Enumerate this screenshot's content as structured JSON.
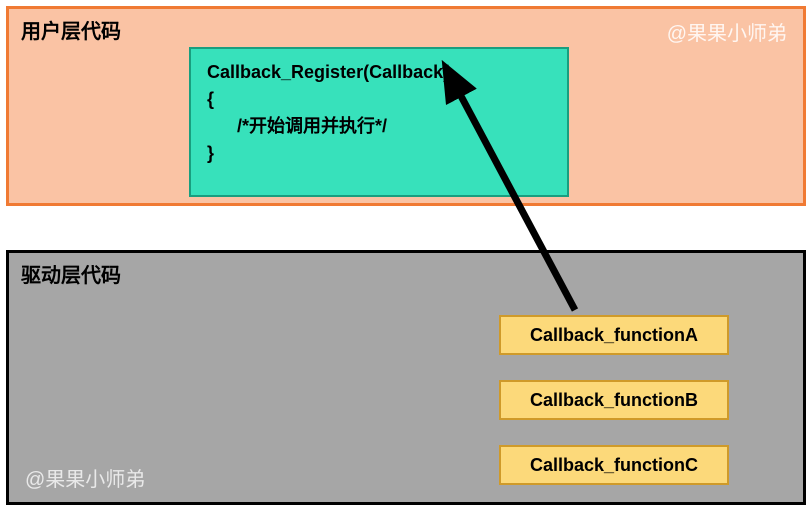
{
  "user_layer": {
    "title": "用户层代码",
    "watermark": "@果果小师弟",
    "code": {
      "line1": "Callback_Register(Callback)",
      "line2": "{",
      "line3": "      /*开始调用并执行*/",
      "line4": "}"
    }
  },
  "driver_layer": {
    "title": "驱动层代码",
    "watermark": "@果果小师弟",
    "functions": {
      "a": "Callback_functionA",
      "b": "Callback_functionB",
      "c": "Callback_functionC"
    }
  },
  "arrow": {
    "from": "Callback_functionA",
    "to": "Callback_Register(Callback)"
  }
}
